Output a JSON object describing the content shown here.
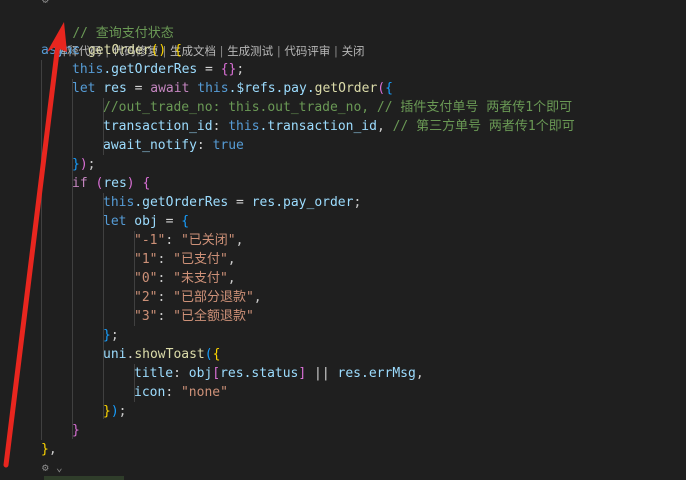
{
  "codelens": {
    "comment": "// 查询支付状态",
    "actions": [
      "解释代码",
      "代码修复",
      "生成文档",
      "生成测试",
      "代码评审",
      "关闭"
    ],
    "separator": " | "
  },
  "code": {
    "l_async_1": "async",
    "l_async_2": " getOrder",
    "l_async_3": "() ",
    "l_async_4": "{",
    "l_this1_a": "this",
    "l_this1_b": ".getOrderRes",
    "l_this1_c": " = ",
    "l_this1_d": "{}",
    "l_this1_e": ";",
    "l_let1_a": "let",
    "l_let1_b": " res",
    "l_let1_c": " = ",
    "l_let1_d": "await",
    "l_let1_e": " this",
    "l_let1_f": ".$refs.pay.",
    "l_let1_g": "getOrder",
    "l_let1_h": "(",
    "l_let1_i": "{",
    "l_cmt1": "//out_trade_no: this.out_trade_no, // 插件支付单号 两者传1个即可",
    "l_tx_a": "transaction_id",
    "l_tx_b": ": ",
    "l_tx_c": "this",
    "l_tx_d": ".transaction_id",
    "l_tx_e": ", ",
    "l_tx_f": "// 第三方单号 两者传1个即可",
    "l_an_a": "await_notify",
    "l_an_b": ": ",
    "l_an_c": "true",
    "l_close1_a": "}",
    "l_close1_b": ")",
    "l_close1_c": ";",
    "l_if_a": "if",
    "l_if_b": " (",
    "l_if_c": "res",
    "l_if_d": ") ",
    "l_if_e": "{",
    "l_this2_a": "this",
    "l_this2_b": ".getOrderRes",
    "l_this2_c": " = ",
    "l_this2_d": "res.pay_order",
    "l_this2_e": ";",
    "l_obj_a": "let",
    "l_obj_b": " obj",
    "l_obj_c": " = ",
    "l_obj_d": "{",
    "m1_k": "\"-1\"",
    "m1_v": "\"已关闭\"",
    "m2_k": "\"1\"",
    "m2_v": "\"已支付\"",
    "m3_k": "\"0\"",
    "m3_v": "\"未支付\"",
    "m4_k": "\"2\"",
    "m4_v": "\"已部分退款\"",
    "m5_k": "\"3\"",
    "m5_v": "\"已全额退款\"",
    "colon": ": ",
    "comma": ",",
    "l_objclose_a": "}",
    "l_objclose_b": ";",
    "l_toast_a": "uni",
    "l_toast_b": ".",
    "l_toast_c": "showToast",
    "l_toast_d": "(",
    "l_toast_e": "{",
    "l_title_a": "title",
    "l_title_b": ": ",
    "l_title_c": "obj",
    "l_title_d": "[",
    "l_title_e": "res.status",
    "l_title_f": "]",
    "l_title_g": " || ",
    "l_title_h": "res.errMsg",
    "l_title_i": ",",
    "l_icon_a": "icon",
    "l_icon_b": ": ",
    "l_icon_c": "\"none\"",
    "l_toastclose_a": "}",
    "l_toastclose_b": ")",
    "l_toastclose_c": ";",
    "l_ifclose": "}",
    "l_fnclose_a": "}",
    "l_fnclose_b": ","
  },
  "icons": {
    "lens_gear": "gear-icon",
    "bottom_gear": "gear-icon"
  },
  "colors": {
    "background": "#1f1f1f",
    "arrow": "#e8261f"
  }
}
